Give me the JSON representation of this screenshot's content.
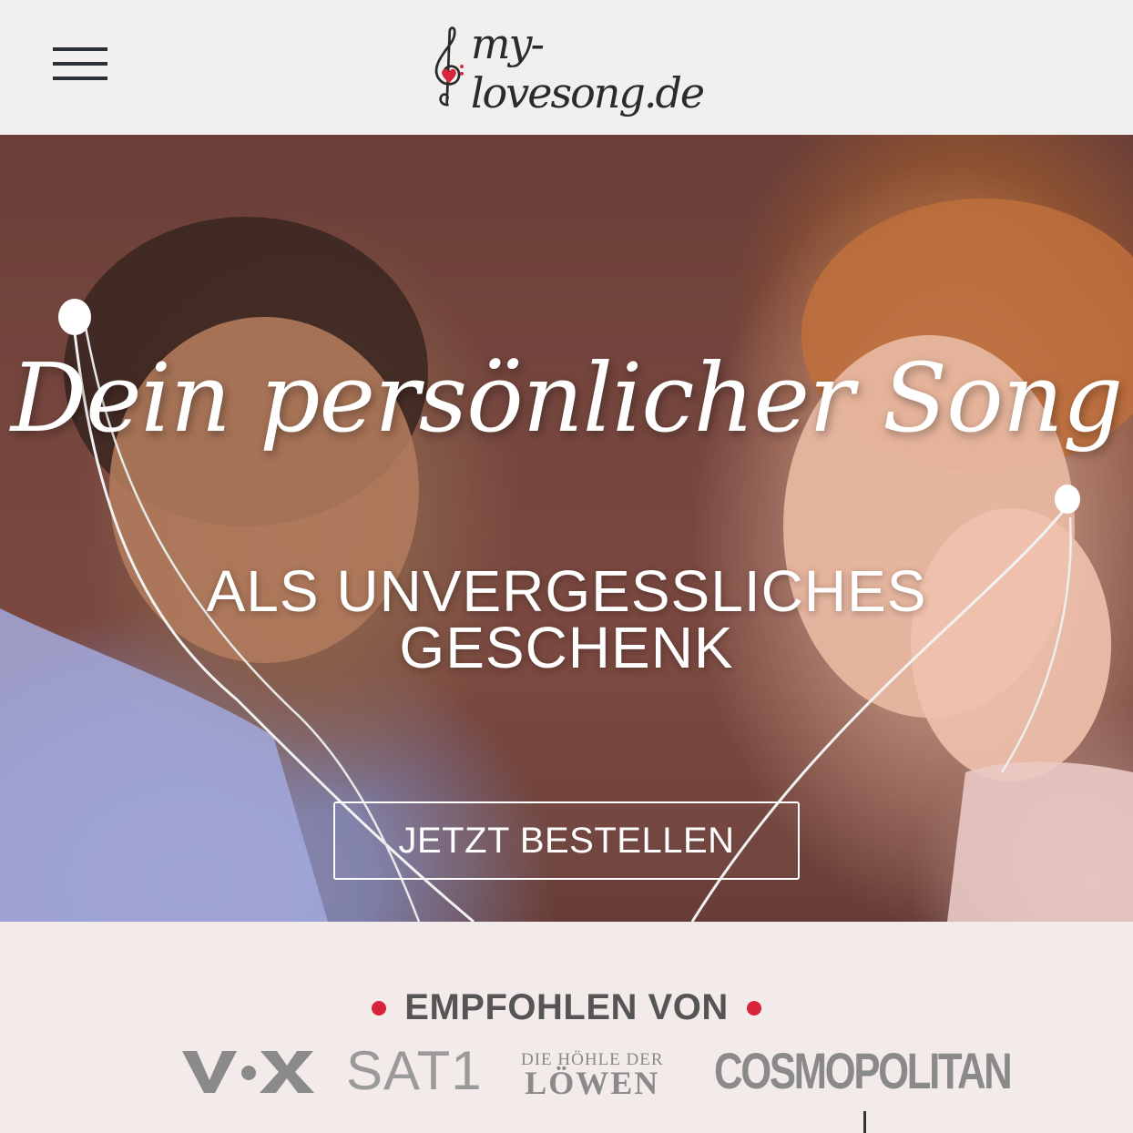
{
  "header": {
    "menu_icon": "hamburger-menu-icon",
    "logo_text": "my-lovesong.de",
    "logo_icon": "treble-clef-heart-icon"
  },
  "hero": {
    "headline": "Dein persönlicher Song",
    "subline_1": "ALS UNVERGESSLICHES",
    "subline_2": "GESCHENK",
    "cta_label": "JETZT BESTELLEN"
  },
  "featured": {
    "heading": "EMPFOHLEN VON",
    "logos": [
      {
        "name": "VOX"
      },
      {
        "name": "SAT.1",
        "display": "SAT1"
      },
      {
        "name": "Die Höhle der Löwen",
        "line1": "DIE HÖHLE DER",
        "line2": "LÖWEN"
      },
      {
        "name": "COSMOPOLITAN",
        "display": "COSMOPOLITAN"
      }
    ]
  },
  "colors": {
    "accent": "#d7243a",
    "text_dark": "#2b2f38",
    "heading_gray": "#555555",
    "logo_gray": "#8a8a8a",
    "background": "#f3ebe9"
  }
}
